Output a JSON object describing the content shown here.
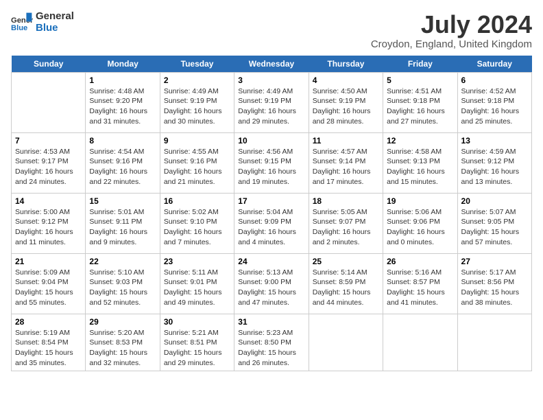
{
  "header": {
    "logo_general": "General",
    "logo_blue": "Blue",
    "month_title": "July 2024",
    "location": "Croydon, England, United Kingdom"
  },
  "days_of_week": [
    "Sunday",
    "Monday",
    "Tuesday",
    "Wednesday",
    "Thursday",
    "Friday",
    "Saturday"
  ],
  "weeks": [
    [
      {
        "day": "",
        "content": ""
      },
      {
        "day": "1",
        "content": "Sunrise: 4:48 AM\nSunset: 9:20 PM\nDaylight: 16 hours and 31 minutes."
      },
      {
        "day": "2",
        "content": "Sunrise: 4:49 AM\nSunset: 9:19 PM\nDaylight: 16 hours and 30 minutes."
      },
      {
        "day": "3",
        "content": "Sunrise: 4:49 AM\nSunset: 9:19 PM\nDaylight: 16 hours and 29 minutes."
      },
      {
        "day": "4",
        "content": "Sunrise: 4:50 AM\nSunset: 9:19 PM\nDaylight: 16 hours and 28 minutes."
      },
      {
        "day": "5",
        "content": "Sunrise: 4:51 AM\nSunset: 9:18 PM\nDaylight: 16 hours and 27 minutes."
      },
      {
        "day": "6",
        "content": "Sunrise: 4:52 AM\nSunset: 9:18 PM\nDaylight: 16 hours and 25 minutes."
      }
    ],
    [
      {
        "day": "7",
        "content": "Sunrise: 4:53 AM\nSunset: 9:17 PM\nDaylight: 16 hours and 24 minutes."
      },
      {
        "day": "8",
        "content": "Sunrise: 4:54 AM\nSunset: 9:16 PM\nDaylight: 16 hours and 22 minutes."
      },
      {
        "day": "9",
        "content": "Sunrise: 4:55 AM\nSunset: 9:16 PM\nDaylight: 16 hours and 21 minutes."
      },
      {
        "day": "10",
        "content": "Sunrise: 4:56 AM\nSunset: 9:15 PM\nDaylight: 16 hours and 19 minutes."
      },
      {
        "day": "11",
        "content": "Sunrise: 4:57 AM\nSunset: 9:14 PM\nDaylight: 16 hours and 17 minutes."
      },
      {
        "day": "12",
        "content": "Sunrise: 4:58 AM\nSunset: 9:13 PM\nDaylight: 16 hours and 15 minutes."
      },
      {
        "day": "13",
        "content": "Sunrise: 4:59 AM\nSunset: 9:12 PM\nDaylight: 16 hours and 13 minutes."
      }
    ],
    [
      {
        "day": "14",
        "content": "Sunrise: 5:00 AM\nSunset: 9:12 PM\nDaylight: 16 hours and 11 minutes."
      },
      {
        "day": "15",
        "content": "Sunrise: 5:01 AM\nSunset: 9:11 PM\nDaylight: 16 hours and 9 minutes."
      },
      {
        "day": "16",
        "content": "Sunrise: 5:02 AM\nSunset: 9:10 PM\nDaylight: 16 hours and 7 minutes."
      },
      {
        "day": "17",
        "content": "Sunrise: 5:04 AM\nSunset: 9:09 PM\nDaylight: 16 hours and 4 minutes."
      },
      {
        "day": "18",
        "content": "Sunrise: 5:05 AM\nSunset: 9:07 PM\nDaylight: 16 hours and 2 minutes."
      },
      {
        "day": "19",
        "content": "Sunrise: 5:06 AM\nSunset: 9:06 PM\nDaylight: 16 hours and 0 minutes."
      },
      {
        "day": "20",
        "content": "Sunrise: 5:07 AM\nSunset: 9:05 PM\nDaylight: 15 hours and 57 minutes."
      }
    ],
    [
      {
        "day": "21",
        "content": "Sunrise: 5:09 AM\nSunset: 9:04 PM\nDaylight: 15 hours and 55 minutes."
      },
      {
        "day": "22",
        "content": "Sunrise: 5:10 AM\nSunset: 9:03 PM\nDaylight: 15 hours and 52 minutes."
      },
      {
        "day": "23",
        "content": "Sunrise: 5:11 AM\nSunset: 9:01 PM\nDaylight: 15 hours and 49 minutes."
      },
      {
        "day": "24",
        "content": "Sunrise: 5:13 AM\nSunset: 9:00 PM\nDaylight: 15 hours and 47 minutes."
      },
      {
        "day": "25",
        "content": "Sunrise: 5:14 AM\nSunset: 8:59 PM\nDaylight: 15 hours and 44 minutes."
      },
      {
        "day": "26",
        "content": "Sunrise: 5:16 AM\nSunset: 8:57 PM\nDaylight: 15 hours and 41 minutes."
      },
      {
        "day": "27",
        "content": "Sunrise: 5:17 AM\nSunset: 8:56 PM\nDaylight: 15 hours and 38 minutes."
      }
    ],
    [
      {
        "day": "28",
        "content": "Sunrise: 5:19 AM\nSunset: 8:54 PM\nDaylight: 15 hours and 35 minutes."
      },
      {
        "day": "29",
        "content": "Sunrise: 5:20 AM\nSunset: 8:53 PM\nDaylight: 15 hours and 32 minutes."
      },
      {
        "day": "30",
        "content": "Sunrise: 5:21 AM\nSunset: 8:51 PM\nDaylight: 15 hours and 29 minutes."
      },
      {
        "day": "31",
        "content": "Sunrise: 5:23 AM\nSunset: 8:50 PM\nDaylight: 15 hours and 26 minutes."
      },
      {
        "day": "",
        "content": ""
      },
      {
        "day": "",
        "content": ""
      },
      {
        "day": "",
        "content": ""
      }
    ]
  ]
}
